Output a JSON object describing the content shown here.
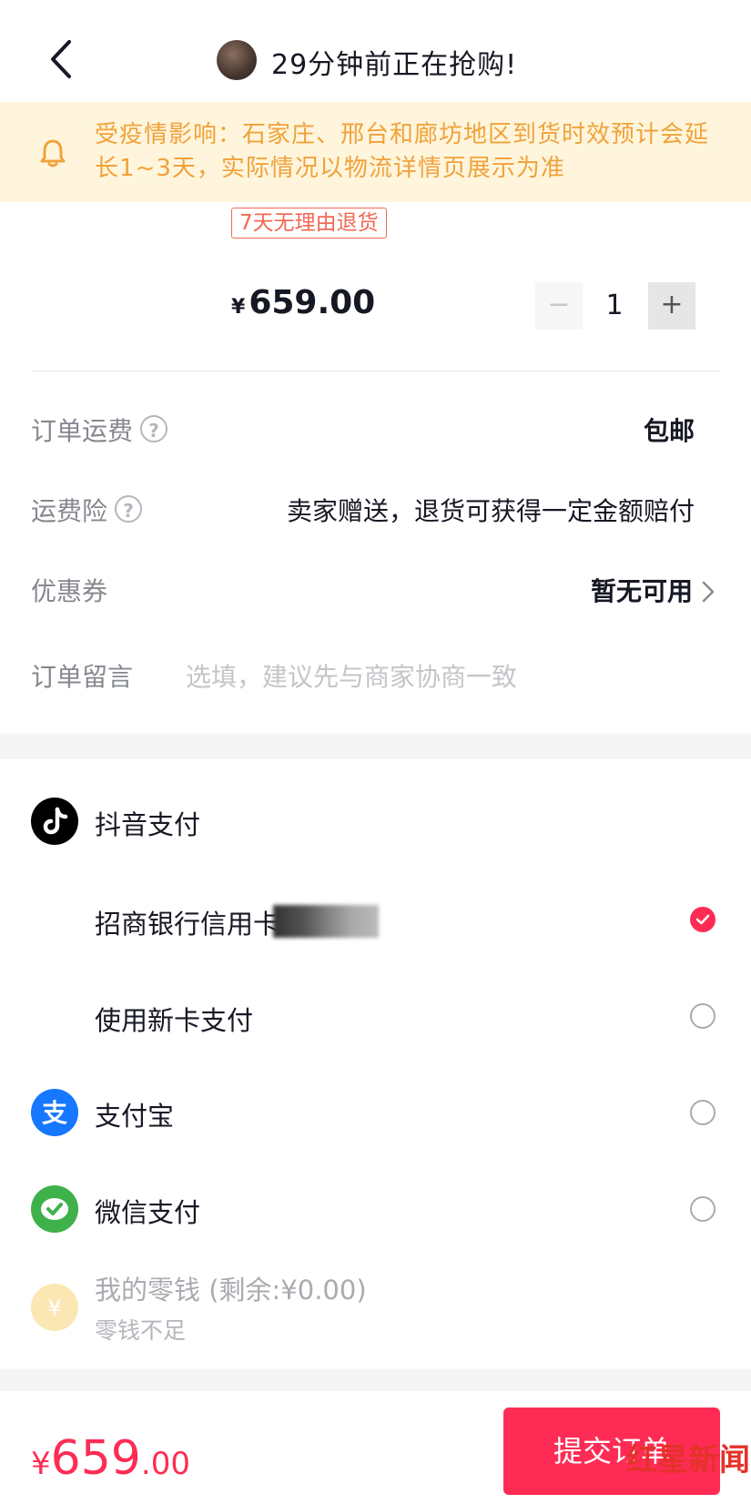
{
  "header": {
    "title": "29分钟前正在抢购!"
  },
  "notice": {
    "text": "受疫情影响：石家庄、邢台和廊坊地区到货时效预计会延长1~3天，实际情况以物流详情页展示为准"
  },
  "product": {
    "return_policy": "7天无理由退货",
    "currency": "¥",
    "price": "659.00",
    "quantity": "1",
    "minus": "−",
    "plus": "+"
  },
  "order": {
    "shipping_label": "订单运费",
    "shipping_value": "包邮",
    "insurance_label": "运费险",
    "insurance_value": "卖家赠送，退货可获得一定金额赔付",
    "coupon_label": "优惠券",
    "coupon_value": "暂无可用",
    "message_label": "订单留言",
    "message_placeholder": "选填，建议先与商家协商一致",
    "help_glyph": "?"
  },
  "payment": {
    "douyin_label": "抖音支付",
    "bank_card_label": "招商银行信用卡",
    "new_card_label": "使用新卡支付",
    "alipay_label": "支付宝",
    "wechat_label": "微信支付",
    "wallet_label": "我的零钱 (剩余:¥0.00)",
    "wallet_sub": "零钱不足",
    "selected": "bank_card"
  },
  "footer": {
    "currency": "¥",
    "total_int": "659",
    "total_dec": ".00",
    "submit_label": "提交订单"
  },
  "watermark": {
    "text": "红星新闻"
  },
  "colors": {
    "accent": "#fe2c55",
    "notice_bg": "#fff5dc",
    "notice_text": "#f0a23b"
  }
}
